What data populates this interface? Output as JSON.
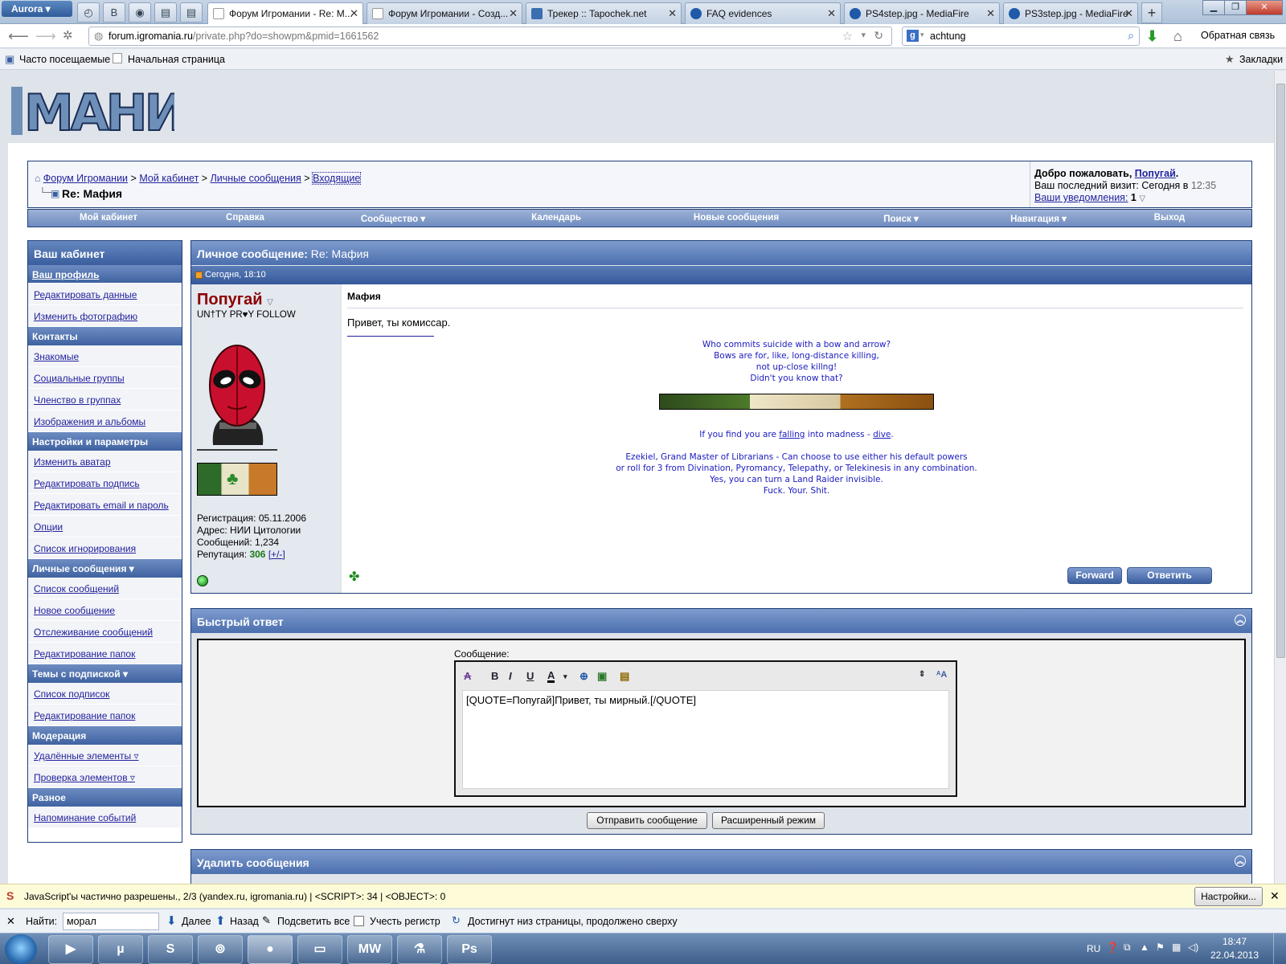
{
  "browser": {
    "app_button": "Aurora",
    "tabs": [
      {
        "title": "Форум Игромании - Re: М...",
        "active": true
      },
      {
        "title": "Форум Игромании - Созд...",
        "active": false
      },
      {
        "title": "Трекер :: Tapochek.net",
        "active": false
      },
      {
        "title": "FAQ evidences",
        "active": false
      },
      {
        "title": "PS4step.jpg - MediaFire",
        "active": false
      },
      {
        "title": "PS3step.jpg - MediaFire",
        "active": false
      }
    ],
    "new_tab": "+",
    "url_host": "forum.igromania.ru",
    "url_path": "/private.php?do=showpm&pmid=1661562",
    "search_value": "achtung",
    "feedback_label": "Обратная связь",
    "bookmarks": [
      "Часто посещаемые",
      "Начальная страница"
    ],
    "bookmarks_menu": "Закладки"
  },
  "breadcrumb": {
    "items": [
      "Форум Игромании",
      "Мой кабинет",
      "Личные сообщения",
      "Входящие"
    ],
    "separator": ">",
    "title": "Re: Мафия"
  },
  "welcome": {
    "greeting": "Добро пожаловать,",
    "username": "Попугай",
    "last_visit_label": "Ваш последний визит: Сегодня в",
    "last_visit_time": "12:35",
    "notifications_label": "Ваши уведомления:",
    "notifications_count": "1"
  },
  "mainnav": [
    "Мой кабинет",
    "Справка",
    "Сообщество ▾",
    "Календарь",
    "Новые сообщения",
    "Поиск ▾",
    "Навигация ▾",
    "Выход"
  ],
  "sidebar": {
    "title": "Ваш кабинет",
    "sections": [
      {
        "header": "Ваш профиль",
        "header_link": true,
        "items": [
          "Редактировать данные",
          "Изменить фотографию"
        ]
      },
      {
        "header": "Контакты",
        "items": [
          "Знакомые",
          "Социальные группы",
          "Членство в группах",
          "Изображения и альбомы"
        ]
      },
      {
        "header": "Настройки и параметры",
        "items": [
          "Изменить аватар",
          "Редактировать подпись",
          "Редактировать email и пароль",
          "Опции",
          "Список игнорирования"
        ]
      },
      {
        "header": "Личные сообщения ▾",
        "items": [
          "Список сообщений",
          "Новое сообщение",
          "Отслеживание сообщений",
          "Редактирование папок"
        ]
      },
      {
        "header": "Темы с подпиской ▾",
        "items": [
          "Список подписок",
          "Редактирование папок"
        ]
      },
      {
        "header": "Модерация",
        "items": [
          "Удалённые элементы ▿",
          "Проверка элементов ▿"
        ]
      },
      {
        "header": "Разное",
        "items": [
          "Напоминание событий"
        ]
      }
    ]
  },
  "message": {
    "panel_title": "Личное сообщение:",
    "panel_subject": "Re: Мафия",
    "date": "Сегодня, 18:10",
    "username": "Попугай",
    "user_title": "UN†TY PR♥Y FOLLOW",
    "reg_label": "Регистрация:",
    "reg_value": "05.11.2006",
    "addr_label": "Адрес:",
    "addr_value": "НИИ Цитологии",
    "posts_label": "Сообщений:",
    "posts_value": "1,234",
    "rep_label": "Репутация:",
    "rep_value": "306",
    "rep_link": "[+/-]",
    "title": "Мафия",
    "text": "Привет, ты комиссар.",
    "signature": {
      "lines1": [
        "Who commits suicide with a bow and arrow?",
        "Bows are for, like, long-distance killing,",
        "not up-close killng!",
        "Didn't you know that?"
      ],
      "madness_pre": "If you find you are ",
      "madness_link1": "falling",
      "madness_mid": " into madness - ",
      "madness_link2": "dive",
      "madness_post": ".",
      "lines2": [
        "Ezekiel, Grand Master of Librarians - Can choose to use either his default powers",
        "or roll for 3 from Divination, Pyromancy, Telepathy, or Telekinesis in any combination.",
        "Yes, you can turn a Land Raider invisible.",
        "Fuck. Your. Shit."
      ]
    },
    "forward_label": "Forward",
    "reply_label": "Ответить"
  },
  "quick_reply": {
    "title": "Быстрый ответ",
    "message_label": "Сообщение:",
    "text": "[QUOTE=Попугай]Привет, ты мирный.[/QUOTE]",
    "send_label": "Отправить сообщение",
    "advanced_label": "Расширенный режим"
  },
  "delete_section": {
    "title": "Удалить сообщения"
  },
  "notification": {
    "text": "JavaScript'ы частично разрешены., 2/3 (yandex.ru, igromania.ru) | <SCRIPT>: 34 | <OBJECT>: 0",
    "settings_label": "Настройки..."
  },
  "findbar": {
    "label": "Найти:",
    "value": "морал",
    "next": "Далее",
    "prev": "Назад",
    "highlight": "Подсветить все",
    "match_case": "Учесть регистр",
    "status": "Достигнут низ страницы, продолжено сверху"
  },
  "taskbar": {
    "lang": "RU",
    "time": "18:47",
    "date": "22.04.2013"
  },
  "colors": {
    "header_blue": "#3a5e9e",
    "link": "#22229c",
    "username_red": "#8b0000",
    "reputation_green": "#1a7a1a",
    "signature_blue": "#1a1abf"
  }
}
